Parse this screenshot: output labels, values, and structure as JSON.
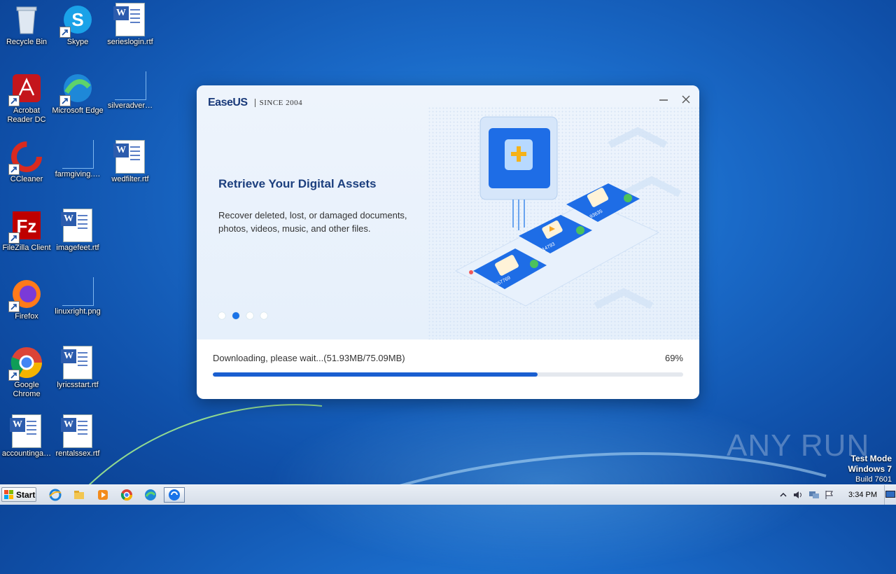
{
  "desktop": {
    "icons": [
      {
        "label": "Recycle Bin",
        "icon": "recycle-bin-icon"
      },
      {
        "label": "Skype",
        "icon": "skype-icon"
      },
      {
        "label": "serieslogin.rtf",
        "icon": "word-doc-icon"
      },
      {
        "label": "Acrobat Reader DC",
        "icon": "acrobat-icon"
      },
      {
        "label": "Microsoft Edge",
        "icon": "edge-icon"
      },
      {
        "label": "silveradver…",
        "icon": "blank-file-icon"
      },
      {
        "label": "CCleaner",
        "icon": "ccleaner-icon"
      },
      {
        "label": "farmgiving.…",
        "icon": "blank-file-icon"
      },
      {
        "label": "wedfilter.rtf",
        "icon": "word-doc-icon"
      },
      {
        "label": "FileZilla Client",
        "icon": "filezilla-icon"
      },
      {
        "label": "imagefeet.rtf",
        "icon": "word-doc-icon"
      },
      {
        "label": "Firefox",
        "icon": "firefox-icon"
      },
      {
        "label": "linuxright.png",
        "icon": "blank-file-icon"
      },
      {
        "label": "Google Chrome",
        "icon": "chrome-icon"
      },
      {
        "label": "lyricsstart.rtf",
        "icon": "word-doc-icon"
      },
      {
        "label": "accountinga…",
        "icon": "word-doc-icon"
      },
      {
        "label": "rentalssex.rtf",
        "icon": "word-doc-icon"
      }
    ]
  },
  "dialog": {
    "logo_brand": "EaseUS",
    "logo_since": "SINCE 2004",
    "title": "Retrieve Your Digital Assets",
    "description": "Recover deleted, lost, or damaged documents, photos, videos, music, and other files.",
    "carousel": {
      "count": 4,
      "active_index": 1
    },
    "illustration_labels": [
      "357769",
      "14793",
      "93635"
    ],
    "status": "Downloading, please wait...(51.93MB/75.09MB)",
    "progress_percent_label": "69%",
    "progress_fraction": 0.69,
    "colors": {
      "accent": "#1a5fd0",
      "title": "#1c3f7e"
    }
  },
  "watermark": {
    "text": "ANY RUN"
  },
  "test_mode": {
    "line1": "Test Mode",
    "line2": "Windows 7",
    "line3": "Build 7601"
  },
  "taskbar": {
    "start_label": "Start",
    "pinned": [
      "ie-icon",
      "explorer-icon",
      "media-player-icon",
      "chrome-icon",
      "edge-icon",
      "easeus-installer-icon"
    ],
    "tray_icons": [
      "show-hidden-icon",
      "volume-icon",
      "network-icon",
      "action-center-flag-icon"
    ],
    "clock": "3:34 PM"
  }
}
